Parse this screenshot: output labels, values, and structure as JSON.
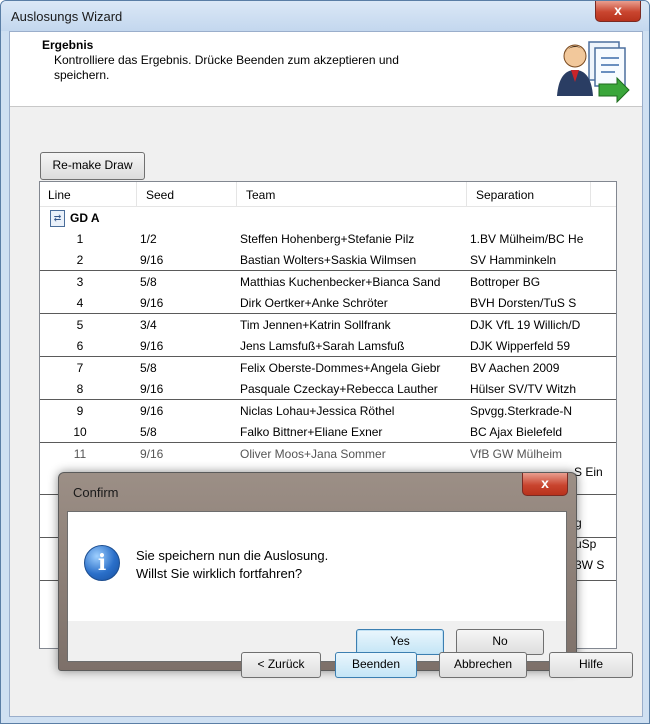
{
  "window": {
    "title": "Auslosungs Wizard",
    "close_glyph": "x"
  },
  "header": {
    "title": "Ergebnis",
    "description": "Kontrolliere das Ergebnis. Drücke Beenden zum akzeptieren und speichern."
  },
  "remake_button": "Re-make Draw",
  "list": {
    "columns": [
      "Line",
      "Seed",
      "Team",
      "Separation"
    ],
    "group": "GD A",
    "rows": [
      {
        "line": "1",
        "seed": "1/2",
        "team": "Steffen Hohenberg+Stefanie Pilz",
        "separation": "1.BV Mülheim/BC He"
      },
      {
        "line": "2",
        "seed": "9/16",
        "team": "Bastian Wolters+Saskia Wilmsen",
        "separation": "SV Hamminkeln"
      },
      {
        "line": "3",
        "seed": "5/8",
        "team": "Matthias Kuchenbecker+Bianca Sand",
        "separation": "Bottroper BG"
      },
      {
        "line": "4",
        "seed": "9/16",
        "team": "Dirk Oertker+Anke Schröter",
        "separation": "BVH Dorsten/TuS S"
      },
      {
        "line": "5",
        "seed": "3/4",
        "team": "Tim Jennen+Katrin Sollfrank",
        "separation": "DJK VfL 19 Willich/D"
      },
      {
        "line": "6",
        "seed": "9/16",
        "team": "Jens Lamsfuß+Sarah Lamsfuß",
        "separation": "DJK Wipperfeld 59"
      },
      {
        "line": "7",
        "seed": "5/8",
        "team": "Felix Oberste-Dommes+Angela Giebr",
        "separation": "BV Aachen 2009"
      },
      {
        "line": "8",
        "seed": "9/16",
        "team": "Pasquale Czeckay+Rebecca Lauther",
        "separation": "Hülser SV/TV Witzh"
      },
      {
        "line": "9",
        "seed": "9/16",
        "team": "Niclas Lohau+Jessica Röthel",
        "separation": "Spvgg.Sterkrade-N"
      },
      {
        "line": "10",
        "seed": "5/8",
        "team": "Falko Bittner+Eliane Exner",
        "separation": "BC Ajax Bielefeld"
      }
    ],
    "partial_rows": [
      {
        "line": "11",
        "seed": "9/16",
        "team": "Oliver Moos+Jana Sommer",
        "separation": "VfB GW Mülheim"
      }
    ],
    "peek_fragments": [
      "S Ein",
      "g",
      "uSp",
      "3W S"
    ]
  },
  "dialog": {
    "title": "Confirm",
    "close_glyph": "x",
    "icon": "info-icon",
    "message_line1": "Sie speichern nun die Auslosung.",
    "message_line2": "Willst Sie wirklich fortfahren?",
    "yes": "Yes",
    "no": "No"
  },
  "footer": {
    "back": "< Zurück",
    "finish": "Beenden",
    "cancel": "Abbrechen",
    "help": "Hilfe"
  },
  "colors": {
    "title_close": "#c9452f",
    "focus_blue": "#3c7fb1",
    "dialog_frame": "#8a7d75"
  }
}
